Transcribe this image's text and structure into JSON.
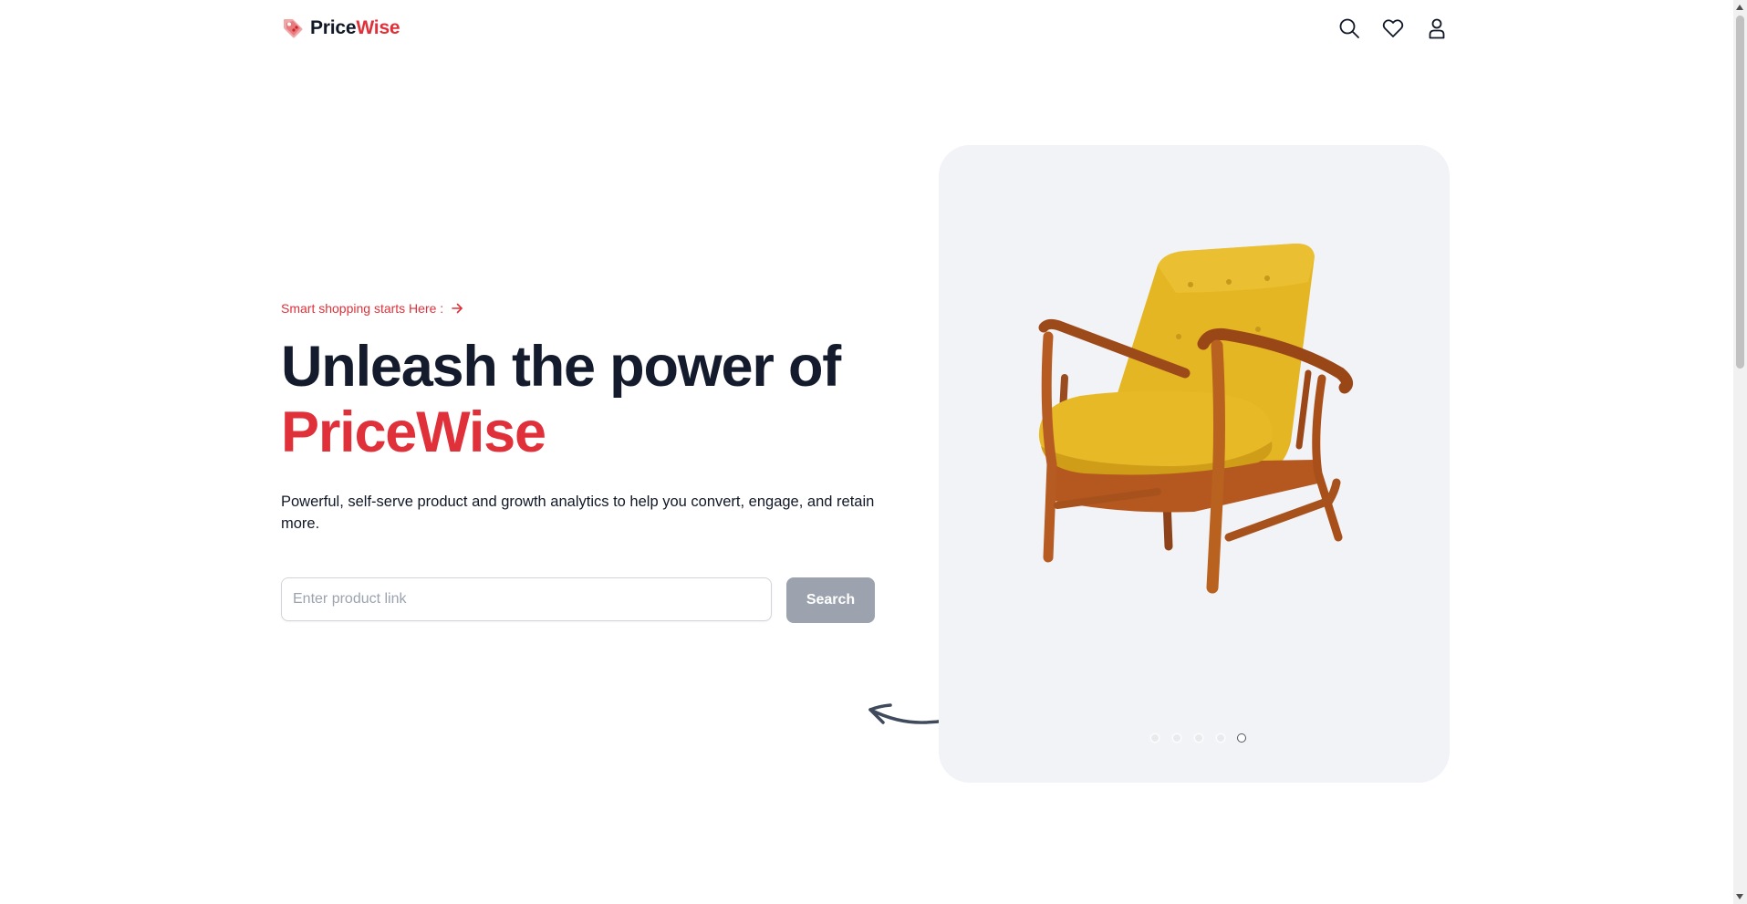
{
  "nav": {
    "logo_main": "Price",
    "logo_accent": "Wise",
    "icons": [
      "search-icon",
      "heart-icon",
      "user-icon"
    ]
  },
  "hero": {
    "tagline": "Smart shopping starts Here :",
    "headline_line1": "Unleash the power of",
    "headline_brand": "PriceWise",
    "description": "Powerful, self-serve product and growth analytics to help you convert, engage, and retain more.",
    "search": {
      "placeholder": "Enter product link",
      "value": "",
      "button_label": "Search"
    }
  },
  "carousel": {
    "slide_count": 5,
    "active_index": 4
  },
  "colors": {
    "brand_red": "#e0313a",
    "heading": "#141b2d",
    "card_bg": "#f2f3f6",
    "button_disabled": "#9ca3af"
  }
}
